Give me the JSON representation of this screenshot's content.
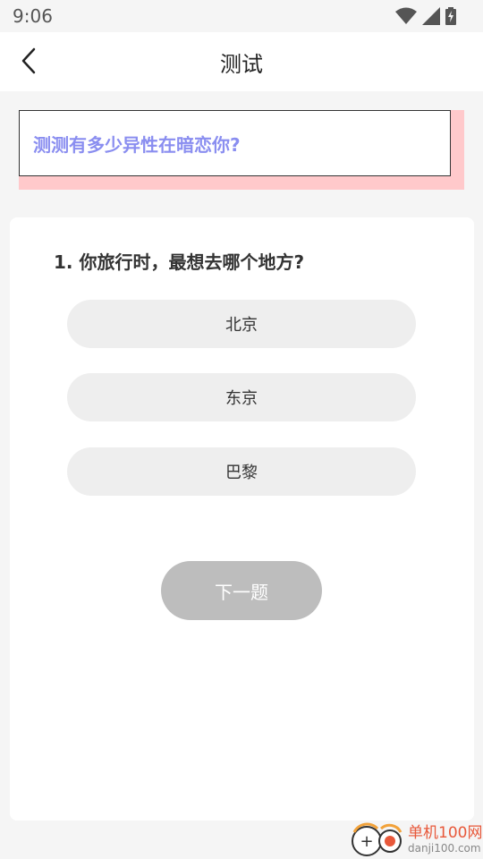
{
  "status_bar": {
    "time": "9:06",
    "icons": [
      "wifi-icon",
      "signal-icon",
      "battery-charging-icon"
    ]
  },
  "header": {
    "title": "测试",
    "back_icon": "chevron-left-icon"
  },
  "banner": {
    "text": "测测有多少异性在暗恋你?"
  },
  "quiz": {
    "question": "1. 你旅行时，最想去哪个地方?",
    "options": [
      {
        "label": "北京"
      },
      {
        "label": "东京"
      },
      {
        "label": "巴黎"
      }
    ],
    "next_label": "下一题"
  },
  "watermark": {
    "title": "单机100网",
    "subtitle": "danji100.com"
  },
  "colors": {
    "banner_text": "#8a8ef0",
    "banner_shadow": "#ffc9cb",
    "option_bg": "#eeeeee",
    "next_bg": "#bdbdbd",
    "watermark": "#e8583a"
  }
}
